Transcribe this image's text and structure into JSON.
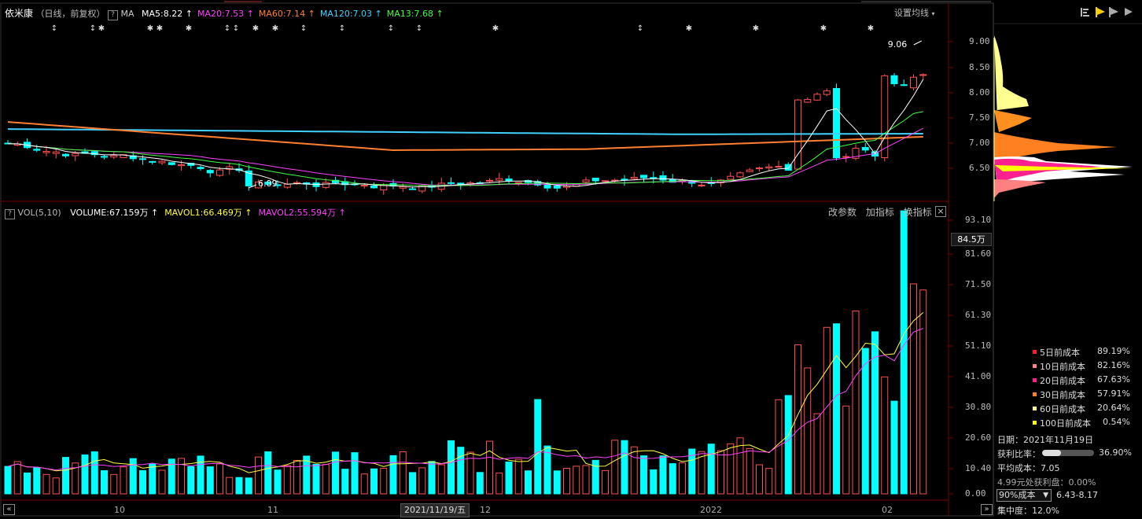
{
  "header": {
    "stock_name": "依米康",
    "period": "（日线，前复权）",
    "help": "?",
    "ma_label": "MA",
    "ma_items": [
      {
        "label": "MA5:8.22",
        "arrow": "↑",
        "color": "#ffffff"
      },
      {
        "label": "MA20:7.53",
        "arrow": "↑",
        "color": "#ff40ff"
      },
      {
        "label": "MA60:7.14",
        "arrow": "↑",
        "color": "#ff8030"
      },
      {
        "label": "MA120:7.03",
        "arrow": "↑",
        "color": "#3fd0ff"
      },
      {
        "label": "MA13:7.68",
        "arrow": "↑",
        "color": "#40ff40"
      }
    ],
    "settings_label": "设置均线"
  },
  "price_axis": [
    "9.00",
    "8.50",
    "8.00",
    "7.50",
    "7.00",
    "6.50"
  ],
  "price_annotations": {
    "high": "9.06",
    "low": "6.09"
  },
  "volume_header": {
    "help": "?",
    "name": "VOL(5,10)",
    "items": [
      {
        "label": "VOLUME:67.159万",
        "arrow": "↑",
        "color": "#ffffff"
      },
      {
        "label": "MAVOL1:66.469万",
        "arrow": "↑",
        "color": "#ffff40"
      },
      {
        "label": "MAVOL2:55.594万",
        "arrow": "↑",
        "color": "#ff40ff"
      }
    ],
    "buttons": [
      "改参数",
      "加指标",
      "换指标"
    ],
    "close": "×"
  },
  "volume_axis": [
    "93.10",
    "81.60",
    "71.50",
    "61.30",
    "51.10",
    "41.00",
    "30.80",
    "20.60",
    "10.40",
    "0.00"
  ],
  "volume_cursor_value": "84.5万",
  "time_axis": {
    "labels": [
      "10",
      "11",
      "12",
      "2022",
      "02"
    ],
    "cursor_date": "2021/11/19/五",
    "left_arrow": "«",
    "right_arrow": "»"
  },
  "cost_distribution": {
    "legend": [
      {
        "label": "5日前成本",
        "pct": "89.19%",
        "color": "#ff2020"
      },
      {
        "label": "10日前成本",
        "pct": "82.16%",
        "color": "#ff8080"
      },
      {
        "label": "20日前成本",
        "pct": "67.63%",
        "color": "#ff2090"
      },
      {
        "label": "30日前成本",
        "pct": "57.91%",
        "color": "#ff8020"
      },
      {
        "label": "60日前成本",
        "pct": "20.64%",
        "color": "#ffff90"
      },
      {
        "label": "100日前成本",
        "pct": "0.54%",
        "color": "#ffff00"
      }
    ],
    "date_line": "日期：2021年11月19日",
    "profit_ratio_label": "获利比率：",
    "profit_ratio": 0.369,
    "profit_ratio_text": "36.90%",
    "avg_cost": "平均成本：7.05",
    "profit_at_price": "4.99元处获利盘：0.00%",
    "cost_select": "90%成本",
    "cost_range": "6.43-8.17",
    "concentration": "集中度：12.0%"
  },
  "toolbar_icons": [
    "chip-flag-icon",
    "chip-flag-active-icon",
    "chip-flag-gray-icon",
    "triangle-play-icon"
  ],
  "colors": {
    "up": "#ff5050",
    "down": "#00ffff",
    "bg": "#000000",
    "grid": "#7a0000"
  }
}
